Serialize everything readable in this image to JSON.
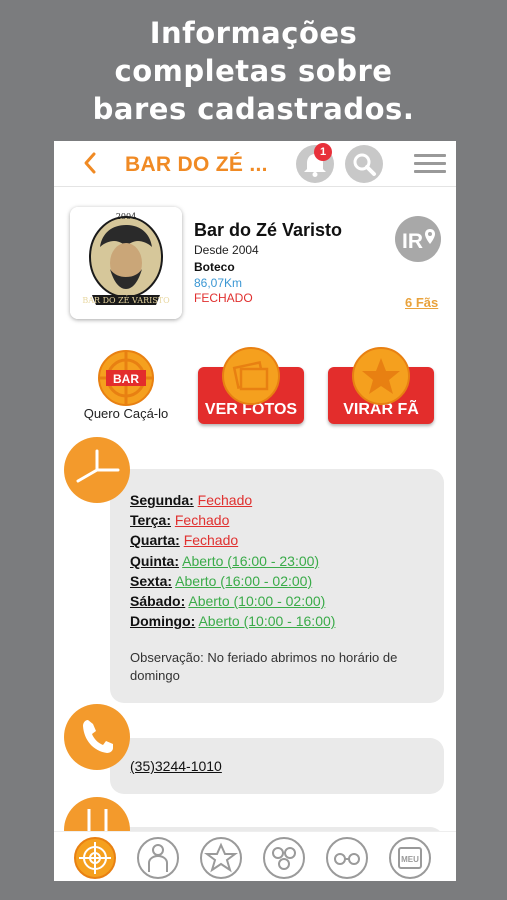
{
  "promo": {
    "line1": "Informações",
    "line2": "completas sobre",
    "line3": "bares cadastrados."
  },
  "topbar": {
    "back_glyph": "‹",
    "title": "BAR DO ZÉ ...",
    "notification_count": "1"
  },
  "bar": {
    "logo_year": "2004",
    "logo_text": "BAR DO ZÉ VARISTO",
    "name": "Bar do Zé Varisto",
    "since": "Desde 2004",
    "type": "Boteco",
    "distance": "86,07Km",
    "status": "FECHADO",
    "fans": "6 Fãs",
    "ir_label": "IR"
  },
  "actions": {
    "hunt_label": "Quero Caçá-lo",
    "hunt_badge": "BAR",
    "photos_label": "VER FOTOS",
    "fan_label": "VIRAR FÃ"
  },
  "hours": [
    {
      "day": "Segunda:",
      "value": "Fechado",
      "state": "closed"
    },
    {
      "day": "Terça:",
      "value": "Fechado",
      "state": "closed"
    },
    {
      "day": "Quarta:",
      "value": "Fechado",
      "state": "closed"
    },
    {
      "day": "Quinta:",
      "value": "Aberto (16:00 - 23:00)",
      "state": "open"
    },
    {
      "day": "Sexta:",
      "value": "Aberto (16:00 - 02:00)",
      "state": "open"
    },
    {
      "day": "Sábado:",
      "value": "Aberto (10:00 - 02:00)",
      "state": "open"
    },
    {
      "day": "Domingo:",
      "value": "Aberto (10:00 - 16:00)",
      "state": "open"
    }
  ],
  "observation": "Observação: No feriado abrimos no horário de domingo",
  "contact": {
    "phone": "(35)3244-1010"
  },
  "bottom_nav": {
    "menu_tab_label": "MEU"
  },
  "colors": {
    "accent": "#f08a24",
    "red": "#e32d2c",
    "open": "#3aab49",
    "closed": "#e0302f",
    "distance": "#3b97d3",
    "fans": "#e9a23b"
  }
}
